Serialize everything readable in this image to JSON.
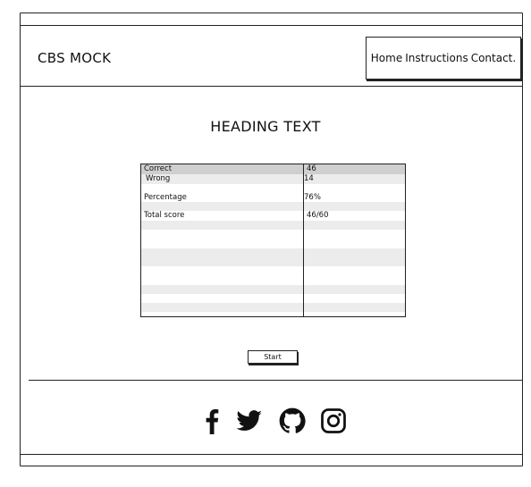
{
  "header": {
    "logo": "CBS MOCK",
    "nav": [
      "Home",
      "Instructions",
      "Contact."
    ]
  },
  "main": {
    "heading": "HEADING TEXT",
    "results": [
      {
        "label": "Correct",
        "value": "46"
      },
      {
        "label": "Wrong",
        "value": "14"
      },
      {
        "label": "Percentage",
        "value": "76%"
      },
      {
        "label": "Total score",
        "value": "46/60"
      }
    ],
    "start_label": "Start"
  },
  "footer": {
    "social_icons": [
      "facebook-icon",
      "twitter-icon",
      "github-icon",
      "instagram-icon"
    ]
  }
}
